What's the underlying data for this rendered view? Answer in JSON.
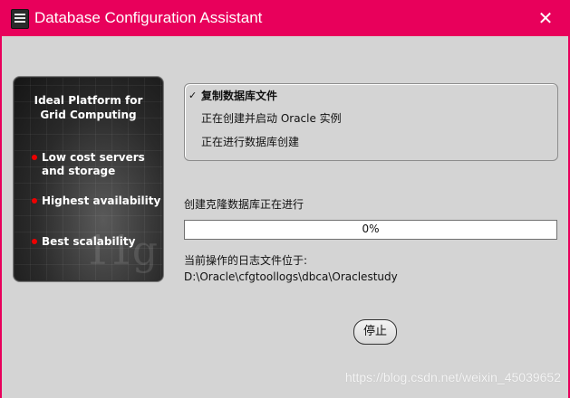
{
  "window": {
    "title": "Database Configuration Assistant",
    "close_glyph": "✕",
    "accent_color": "#e8005b"
  },
  "brand_panel": {
    "title": "Ideal Platform for\nGrid Computing",
    "features": [
      "Low cost servers\nand storage",
      "Highest availability",
      "Best scalability"
    ],
    "mark": "11g"
  },
  "steps": [
    {
      "label": "复制数据库文件",
      "done": true
    },
    {
      "label": "正在创建并启动 Oracle 实例",
      "done": false
    },
    {
      "label": "正在进行数据库创建",
      "done": false
    }
  ],
  "progress": {
    "label": "创建克隆数据库正在进行",
    "value_text": "0%",
    "fraction": 0
  },
  "log": {
    "label": "当前操作的日志文件位于:",
    "path": "D:\\Oracle\\cfgtoollogs\\dbca\\Oraclestudy"
  },
  "buttons": {
    "stop": "停止"
  },
  "watermark": "https://blog.csdn.net/weixin_45039652"
}
